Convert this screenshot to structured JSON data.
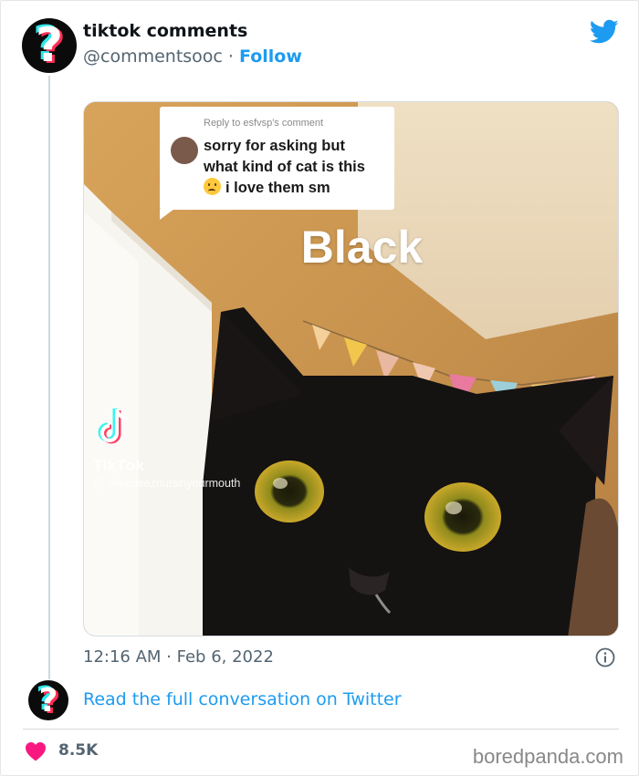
{
  "tweet": {
    "author_name": "tiktok comments",
    "author_handle": "@commentsooc",
    "separator": "·",
    "follow_label": "Follow",
    "timestamp": "12:16 AM · Feb 6, 2022",
    "read_conversation_label": "Read the full conversation on Twitter",
    "likes": "8.5K"
  },
  "media": {
    "reply_header": "Reply to esfvsp's comment",
    "reply_line1": "sorry for asking but",
    "reply_line2": "what kind of cat is this",
    "reply_line3": "i love them sm",
    "overlay_word": "Black",
    "tiktok_brand": "TikTok",
    "tiktok_user": "@ olivedeeznutsinyourmouth"
  },
  "watermark": "boredpanda.com",
  "colors": {
    "link": "#1d9bf0",
    "heart": "#f91880",
    "muted": "#536471"
  },
  "icons": {
    "avatar": "question-mark-icon",
    "brand": "twitter-bird-icon",
    "info": "info-icon",
    "like": "heart-icon"
  }
}
